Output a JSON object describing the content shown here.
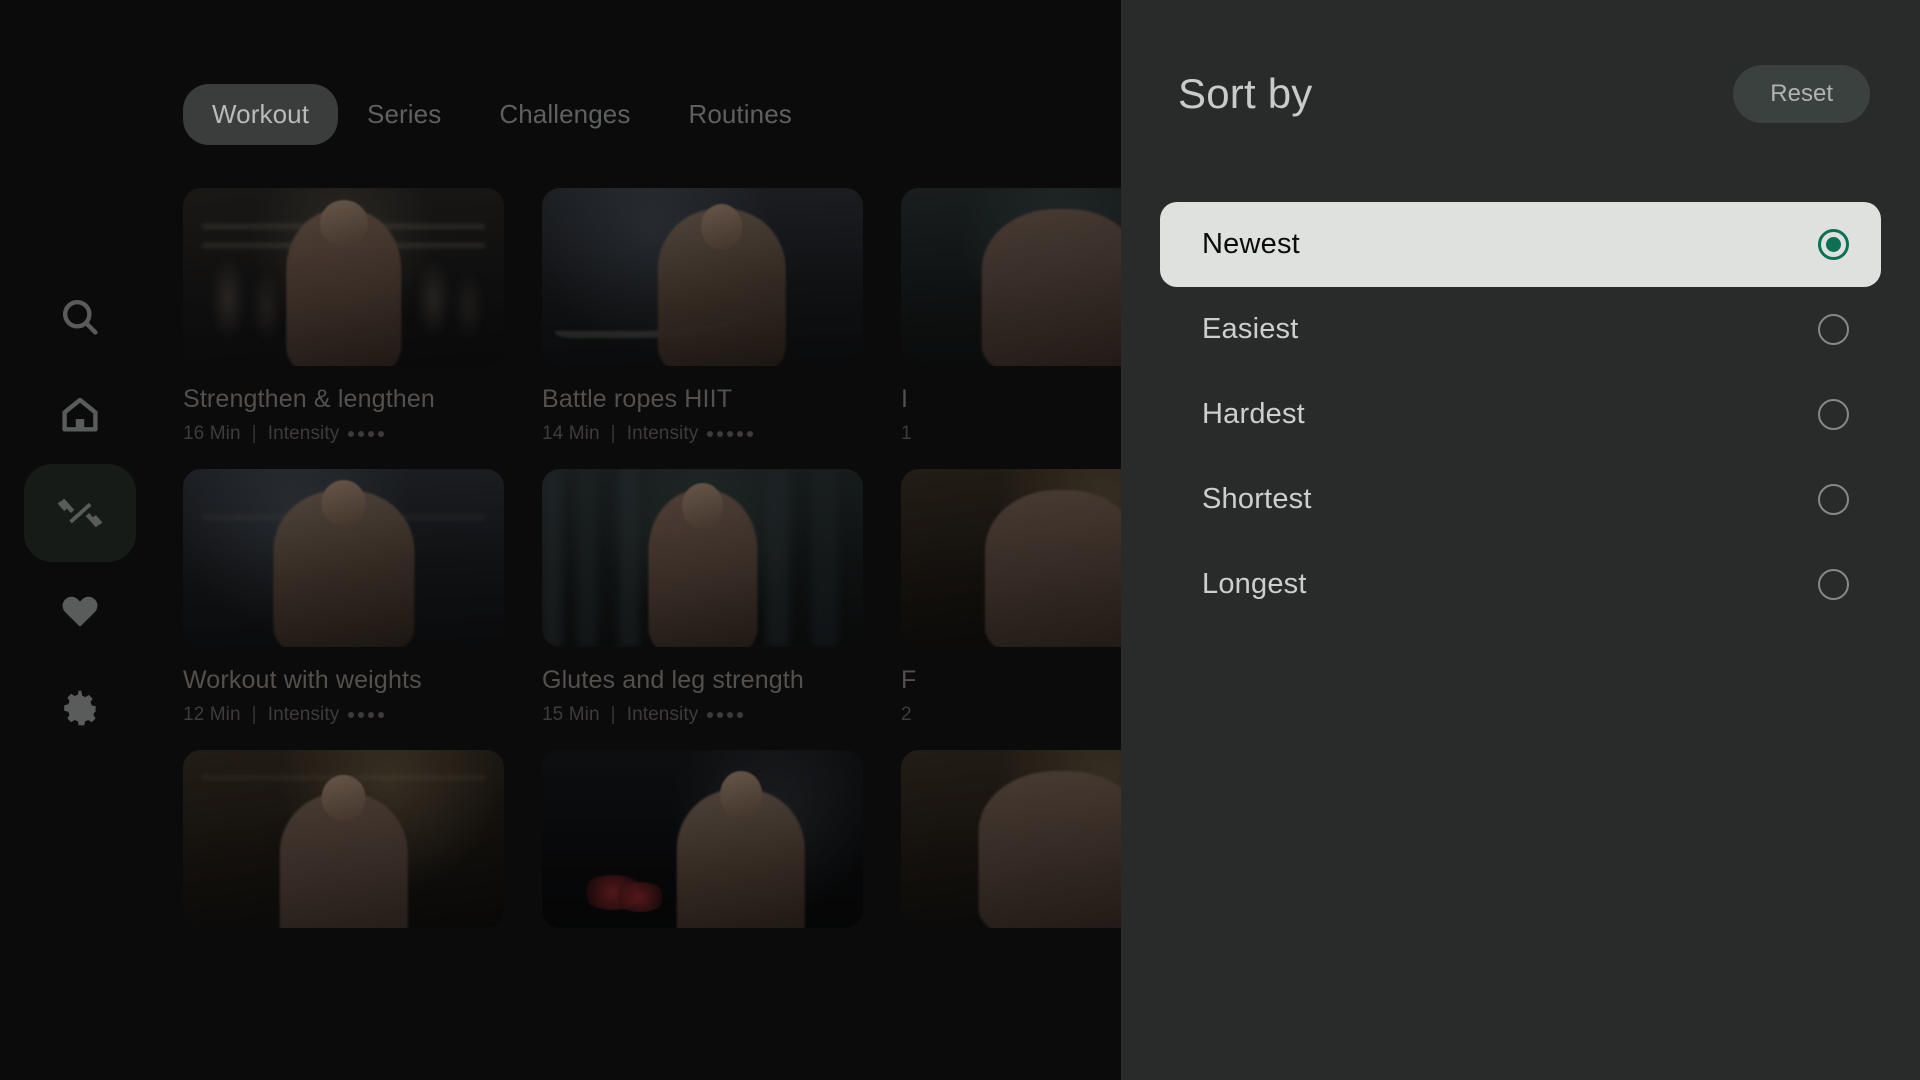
{
  "sidebar": {
    "items": [
      {
        "name": "search",
        "icon": "search-icon"
      },
      {
        "name": "home",
        "icon": "home-icon"
      },
      {
        "name": "workouts",
        "icon": "dumbbell-icon",
        "active": true
      },
      {
        "name": "favorites",
        "icon": "heart-icon"
      },
      {
        "name": "settings",
        "icon": "gear-icon"
      }
    ]
  },
  "tabs": [
    {
      "label": "Workout",
      "active": true
    },
    {
      "label": "Series",
      "active": false
    },
    {
      "label": "Challenges",
      "active": false
    },
    {
      "label": "Routines",
      "active": false
    }
  ],
  "cards": [
    {
      "title": "Strengthen & lengthen",
      "duration": "16 Min",
      "intensity_label": "Intensity",
      "intensity": 4,
      "scene": "crowd-warm"
    },
    {
      "title": "Battle ropes HIIT",
      "duration": "14 Min",
      "intensity_label": "Intensity",
      "intensity": 5,
      "scene": "ropes-cool"
    },
    {
      "title": "I",
      "duration": "1",
      "intensity_label": "",
      "intensity": 0,
      "scene": "teal-clip"
    },
    {
      "title": "Workout with weights",
      "duration": "12 Min",
      "intensity_label": "Intensity",
      "intensity": 4,
      "scene": "cable-cool"
    },
    {
      "title": "Glutes and leg strength",
      "duration": "15 Min",
      "intensity_label": "Intensity",
      "intensity": 4,
      "scene": "city-night"
    },
    {
      "title": "F",
      "duration": "2",
      "intensity_label": "",
      "intensity": 0,
      "scene": "teal-clip"
    },
    {
      "title": "",
      "duration": "",
      "intensity_label": "",
      "intensity": 0,
      "scene": "pushup-warm"
    },
    {
      "title": "",
      "duration": "",
      "intensity_label": "",
      "intensity": 0,
      "scene": "dumbbell-dark"
    },
    {
      "title": "",
      "duration": "",
      "intensity_label": "",
      "intensity": 0,
      "scene": "teal-clip"
    }
  ],
  "meta_separator": "|",
  "panel": {
    "title": "Sort by",
    "reset_label": "Reset",
    "options": [
      {
        "label": "Newest",
        "selected": true
      },
      {
        "label": "Easiest",
        "selected": false
      },
      {
        "label": "Hardest",
        "selected": false
      },
      {
        "label": "Shortest",
        "selected": false
      },
      {
        "label": "Longest",
        "selected": false
      }
    ]
  },
  "colors": {
    "app_background": "#0b0b0b",
    "panel_background": "#282b2a",
    "selected_option_background": "#dfe1de",
    "accent_green": "#0d7055",
    "reset_button_background": "#3b413e",
    "active_tab_background": "#3b3d3c"
  }
}
